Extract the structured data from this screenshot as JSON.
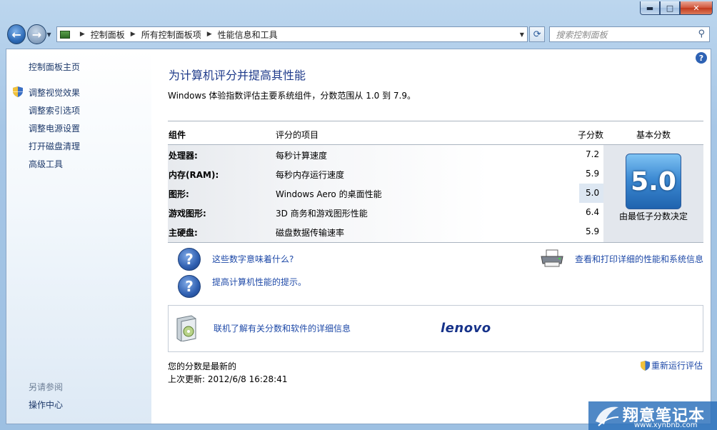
{
  "window": {
    "min_glyph": "▬",
    "max_glyph": "□",
    "close_glyph": "✕"
  },
  "nav": {
    "back_glyph": "←",
    "fwd_glyph": "→",
    "breadcrumb": [
      "控制面板",
      "所有控制面板项",
      "性能信息和工具"
    ],
    "search_placeholder": "搜索控制面板",
    "refresh_glyph": "⟳"
  },
  "sidebar": {
    "home": "控制面板主页",
    "links": [
      "调整视觉效果",
      "调整索引选项",
      "调整电源设置",
      "打开磁盘清理",
      "高级工具"
    ],
    "see_also": "另请参阅",
    "see_also_links": [
      "操作中心"
    ]
  },
  "main": {
    "help": "?",
    "title": "为计算机评分并提高其性能",
    "description": "Windows 体验指数评估主要系统组件，分数范围从 1.0 到 7.9。",
    "table": {
      "headers": {
        "component": "组件",
        "rated": "评分的项目",
        "subscore": "子分数",
        "basescore": "基本分数"
      },
      "rows": [
        {
          "component": "处理器:",
          "rated": "每秒计算速度",
          "subscore": "7.2"
        },
        {
          "component": "内存(RAM):",
          "rated": "每秒内存运行速度",
          "subscore": "5.9"
        },
        {
          "component": "图形:",
          "rated": "Windows Aero 的桌面性能",
          "subscore": "5.0"
        },
        {
          "component": "游戏图形:",
          "rated": "3D 商务和游戏图形性能",
          "subscore": "6.4"
        },
        {
          "component": "主硬盘:",
          "rated": "磁盘数据传输速率",
          "subscore": "5.9"
        }
      ],
      "base_score": "5.0",
      "base_caption": "由最低子分数决定"
    },
    "links": {
      "what_mean": "这些数字意味着什么?",
      "tips": "提高计算机性能的提示。",
      "print_details": "查看和打印详细的性能和系统信息",
      "online_info": "联机了解有关分数和软件的详细信息"
    },
    "oem": "lenovo",
    "status": {
      "current": "您的分数是最新的",
      "last_update": "上次更新: 2012/6/8 16:28:41",
      "rerun": "重新运行评估"
    }
  },
  "watermark": {
    "main": "翔意笔记本",
    "sub": "www.xynbnb.com"
  },
  "colors": {
    "link": "#1f4aa8",
    "title": "#1e3a8a",
    "sidebar_link": "#1e3a6b"
  }
}
